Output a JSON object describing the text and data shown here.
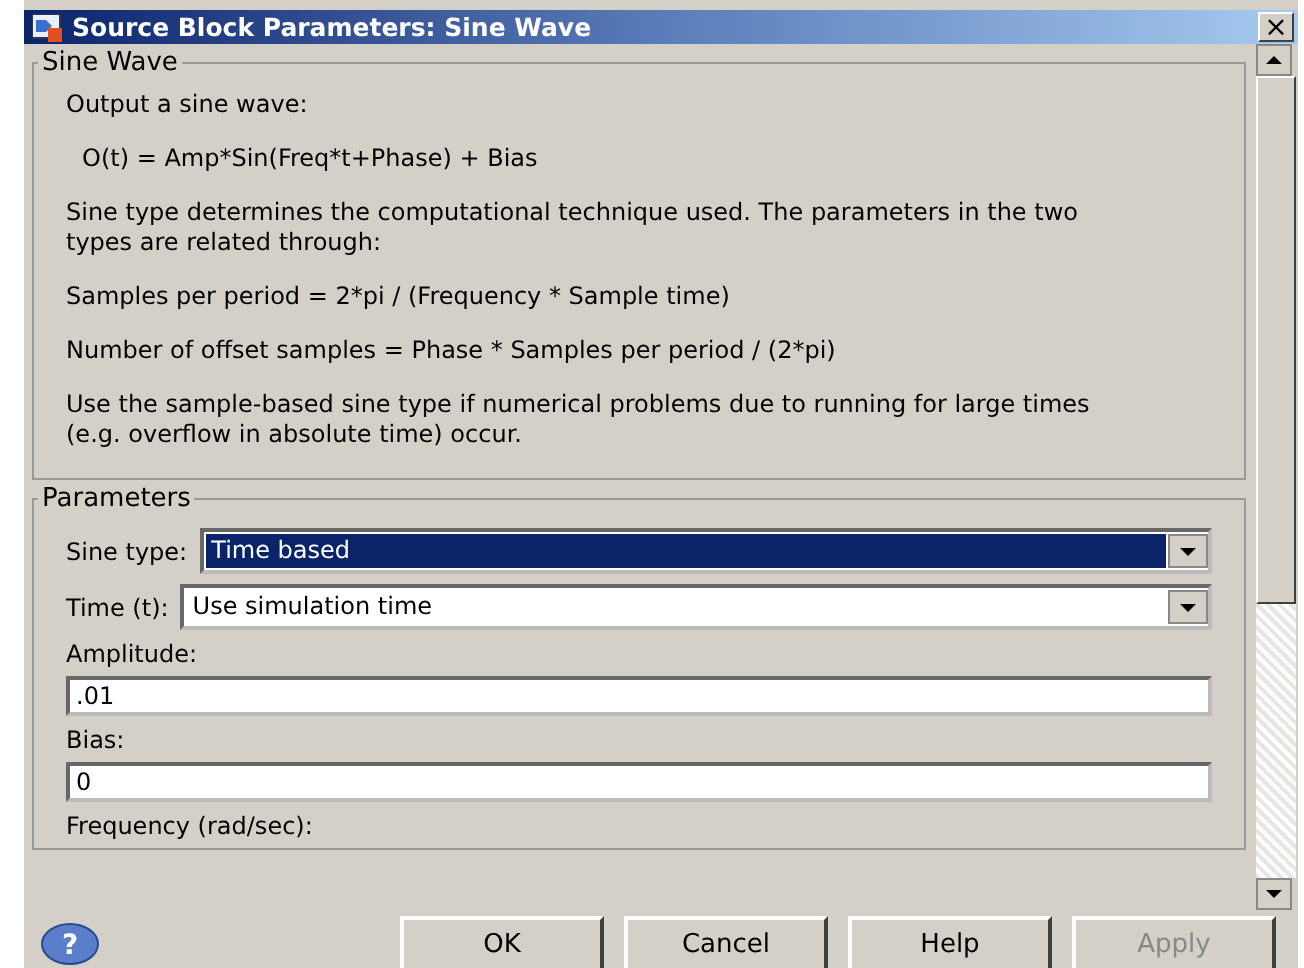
{
  "window": {
    "title": "Source Block Parameters: Sine Wave",
    "close": "×"
  },
  "description": {
    "title": "Sine Wave",
    "paragraphs": [
      "Output a sine wave:",
      "O(t) = Amp*Sin(Freq*t+Phase) + Bias",
      "Sine type determines the computational technique used. The parameters in the two types are related through:",
      "Samples per period = 2*pi / (Frequency * Sample time)",
      "Number of offset samples = Phase * Samples per period / (2*pi)",
      "Use the sample-based sine type if numerical problems due to running for large times (e.g. overflow in absolute time) occur."
    ]
  },
  "parameters": {
    "title": "Parameters",
    "fields": [
      {
        "kind": "dropdown",
        "label": "Sine type:",
        "value": "Time based",
        "selected": true
      },
      {
        "kind": "dropdown",
        "label": "Time (t):",
        "value": "Use simulation time",
        "selected": false
      },
      {
        "kind": "text",
        "label": "Amplitude:",
        "value": ".01"
      },
      {
        "kind": "text",
        "label": "Bias:",
        "value": "0"
      },
      {
        "kind": "label",
        "label": "Frequency (rad/sec):"
      }
    ]
  },
  "help": "?",
  "buttons": [
    {
      "label": "OK",
      "disabled": false
    },
    {
      "label": "Cancel",
      "disabled": false
    },
    {
      "label": "Help",
      "disabled": false
    },
    {
      "label": "Apply",
      "disabled": true
    }
  ]
}
